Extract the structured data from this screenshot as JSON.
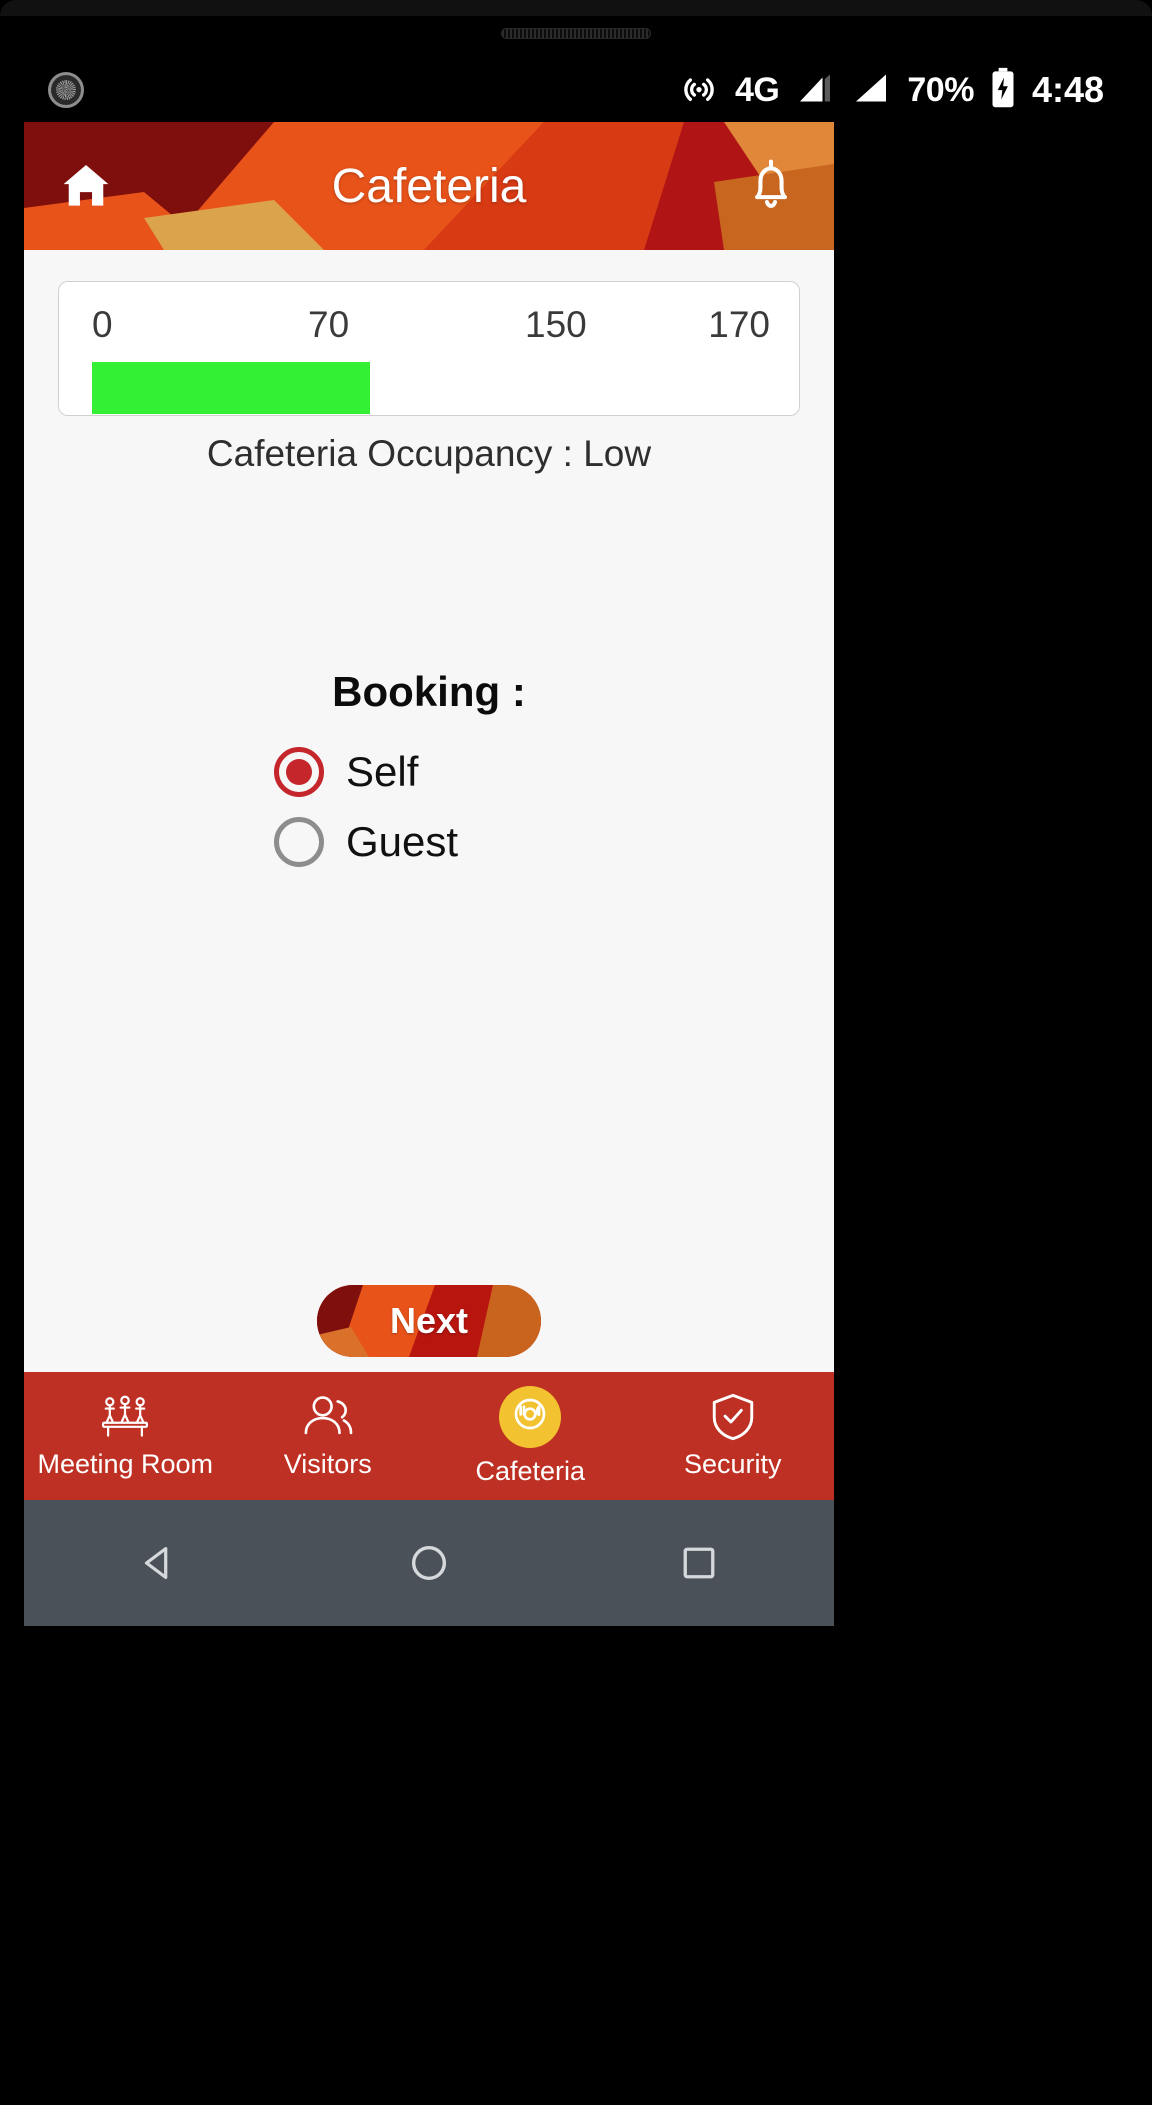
{
  "statusbar": {
    "left_icon": "brightness-dial-icon",
    "hotspot_icon": "hotspot-icon",
    "network": "4G",
    "signal_icon_1": "signal-bars-icon",
    "signal_icon_2": "signal-bars-icon",
    "battery_percent": "70%",
    "battery_icon": "battery-charging-icon",
    "time": "4:48"
  },
  "appbar": {
    "home_icon": "home-icon",
    "title": "Cafeteria",
    "bell_icon": "bell-icon"
  },
  "occupancy": {
    "scale_labels": [
      "0",
      "70",
      "150",
      "170"
    ],
    "scale_values": [
      0,
      70,
      150,
      170
    ],
    "current_value": 70,
    "max_value": 170,
    "bar_color": "#33f034",
    "status_text": "Cafeteria Occupancy : Low",
    "status_level": "Low"
  },
  "booking": {
    "title": "Booking :",
    "options": [
      {
        "label": "Self",
        "selected": true
      },
      {
        "label": "Guest",
        "selected": false
      }
    ],
    "selected_color": "#c4262c",
    "unselected_color": "#8d8d8d"
  },
  "next_button": {
    "label": "Next"
  },
  "bottomnav": {
    "accent_color": "#bf3024",
    "active_badge_color": "#f2c230",
    "items": [
      {
        "label": "Meeting Room",
        "icon": "meeting-room-icon",
        "active": false
      },
      {
        "label": "Visitors",
        "icon": "visitors-icon",
        "active": false
      },
      {
        "label": "Cafeteria",
        "icon": "cafeteria-icon",
        "active": true
      },
      {
        "label": "Security",
        "icon": "shield-check-icon",
        "active": false
      }
    ]
  },
  "androidnav": {
    "back_icon": "back-triangle-icon",
    "home_icon": "home-circle-icon",
    "recents_icon": "recents-square-icon"
  }
}
